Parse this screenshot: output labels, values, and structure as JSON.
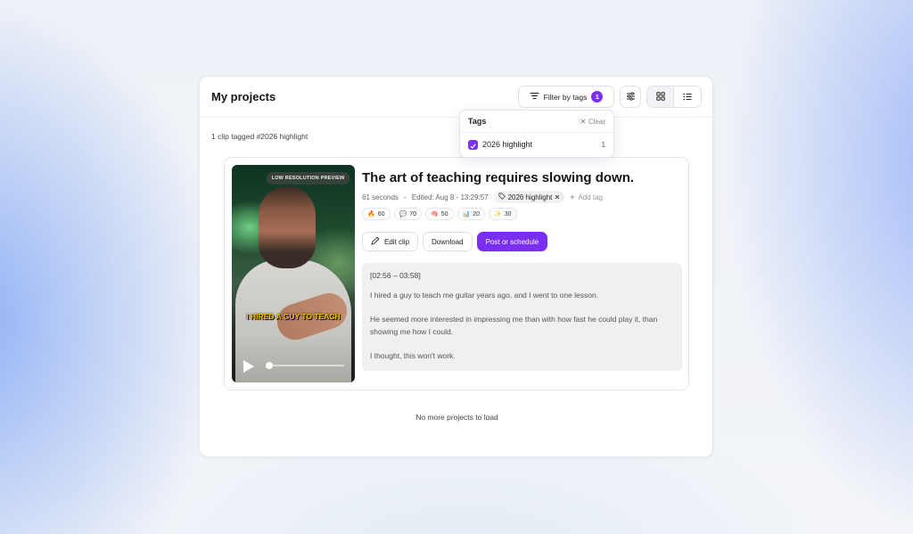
{
  "header": {
    "title": "My projects",
    "filter_label": "Filter by tags",
    "filter_count": "1"
  },
  "summary": "1 clip tagged #2026 highlight",
  "tags_dropdown": {
    "title": "Tags",
    "clear_label": "Clear",
    "items": [
      {
        "label": "2026 highlight",
        "count": "1",
        "checked": true
      }
    ]
  },
  "clip": {
    "preview_badge": "LOW RESOLUTION PREVIEW",
    "caption": "I HIRED A GUY TO TEACH",
    "title": "The art of teaching requires slowing down.",
    "duration": "61 seconds",
    "edited": "Edited: Aug 8 - 13:29:57",
    "tag": "2026 highlight",
    "add_tag": "Add tag",
    "scores": [
      {
        "icon": "fire-icon",
        "glyph": "🔥",
        "value": "60"
      },
      {
        "icon": "chat-icon",
        "glyph": "💬",
        "value": "70"
      },
      {
        "icon": "brain-icon",
        "glyph": "🧠",
        "value": "50"
      },
      {
        "icon": "chart-icon",
        "glyph": "📊",
        "value": "20"
      },
      {
        "icon": "sparkle-icon",
        "glyph": "✨",
        "value": "30"
      }
    ],
    "actions": {
      "edit": "Edit clip",
      "download": "Download",
      "post": "Post or schedule"
    },
    "transcript": {
      "timestamp": "[02:56 – 03:58]",
      "paragraphs": [
        "I hired a guy to teach me guitar years ago, and I went to one lesson.",
        "He seemed more interested in impressing me than with how fast he could play it, than showing me how I could.",
        "I thought, this won't work."
      ]
    }
  },
  "footer": "No more projects to load",
  "colors": {
    "accent": "#7a2ff0"
  }
}
